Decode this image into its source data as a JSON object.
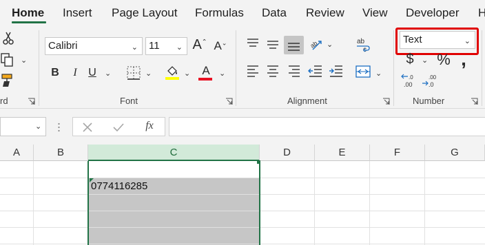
{
  "tabs": [
    "Home",
    "Insert",
    "Page Layout",
    "Formulas",
    "Data",
    "Review",
    "View",
    "Developer",
    "H"
  ],
  "clipboard": {
    "label_partial": "rd"
  },
  "font": {
    "name": "Calibri",
    "size": "11",
    "label": "Font",
    "grow_glyph": "A",
    "shrink_glyph": "A",
    "bold": "B",
    "italic": "I",
    "underline": "U",
    "font_color_glyph": "A",
    "highlight_color": "#ffff00",
    "font_color": "#e81123"
  },
  "alignment": {
    "label": "Alignment",
    "wrap_glyph": "ab/c"
  },
  "number": {
    "format": "Text",
    "label": "Number",
    "currency": "$",
    "percent": "%",
    "comma": ",",
    "inc_decimal": ".0 .00",
    "dec_decimal": ".00 .0",
    "highlight_color": "#e00000"
  },
  "formula_bar": {
    "fx": "fx",
    "value": ""
  },
  "columns": [
    "A",
    "B",
    "C",
    "D",
    "E",
    "F",
    "G"
  ],
  "selected_column": "C",
  "cells": {
    "C2": "0774116285"
  },
  "accent": "#217346"
}
